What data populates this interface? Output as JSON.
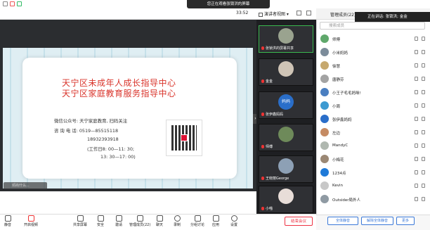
{
  "window": {
    "banner": "您正在观看张锁洪的屏幕",
    "clock": "33:52",
    "view_selector": "演讲者视图"
  },
  "participants_panel": {
    "title": "管理成员(22)",
    "speaking": "正在讲话: 张锁洪; 金金",
    "search_placeholder": "搜索成员",
    "members": [
      {
        "name": "师傅",
        "avatar_color": "#5fa86b"
      },
      {
        "name": "小米妈妈",
        "avatar_color": "#7c8c9a"
      },
      {
        "name": "徐慧",
        "avatar_color": "#c6a86e"
      },
      {
        "name": "唐静芬",
        "avatar_color": "#a3a3a3"
      },
      {
        "name": "小王子毛毛妈咪!",
        "avatar_color": "#4a7fc1"
      },
      {
        "name": "小周",
        "avatar_color": "#3d9ad1"
      },
      {
        "name": "张伊鑫妈妈",
        "avatar_color": "#2a6ec9"
      },
      {
        "name": "左边",
        "avatar_color": "#c58b63"
      },
      {
        "name": "MandyC",
        "avatar_color": "#b0b8b0"
      },
      {
        "name": "小梅花",
        "avatar_color": "#9b8874"
      },
      {
        "name": "1234点",
        "avatar_color": "#1f7ad8"
      },
      {
        "name": "Kevin",
        "avatar_color": "#c8c8c8"
      },
      {
        "name": "Outsider局外人",
        "avatar_color": "#8f9aa3"
      }
    ],
    "mute_all": "全体静音",
    "unmute_all": "解除全体静音",
    "more": "更多"
  },
  "slide": {
    "title_line1": "天宁区未成年人成长指导中心",
    "title_line2": "天宁区家庭教育服务指导中心",
    "wechat": "微信公众号: 天宁家庭教育, 扫码关注",
    "phone": "咨 询 电 话: 0519—85515118",
    "mobile": "18932393918",
    "hours1": "(工作日8: 00—11: 30;",
    "hours2": "13: 30—17: 00)",
    "namepill": "邓尚什么..."
  },
  "thumbnails": [
    {
      "label": "张锁洪的屏幕共享",
      "active": true
    },
    {
      "label": "金金",
      "active": false
    },
    {
      "label": "张伊鑫妈妈",
      "avatar_text": "妈妈",
      "active": false
    },
    {
      "label": "师傅",
      "active": false
    },
    {
      "label": "王晓丽George",
      "active": false
    },
    {
      "label": "小喵",
      "active": false
    }
  ],
  "toolbar": {
    "mute": "静音",
    "start_video": "开启视频",
    "share_screen": "共享屏幕",
    "security": "安全",
    "invite": "邀请",
    "manage_members": "管理成员(22)",
    "chat": "聊天",
    "record": "录制",
    "breakout": "分组讨论",
    "apps": "应用",
    "settings": "设置",
    "end_meeting": "结束会议"
  },
  "colors": {
    "slide_title": "#d9342b",
    "active_thumb": "#3bba4f",
    "accent_blue": "#3a78d8",
    "end_red": "#e34"
  }
}
